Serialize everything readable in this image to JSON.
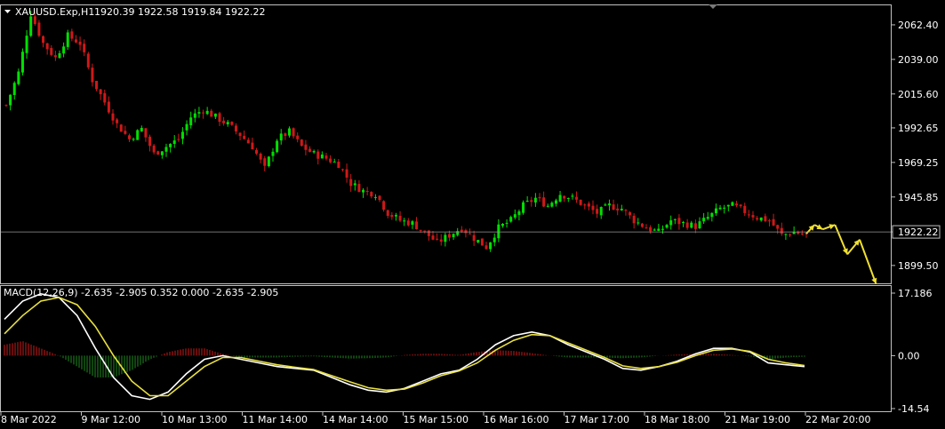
{
  "header": {
    "symbol": "XAUUSD.Exp,H1",
    "ohlc": "1920.39 1922.58 1919.84 1922.22"
  },
  "macd_header": {
    "label": "MACD(12,26,9) -2.635 -2.905 0.352 0.000 -2.635 -2.905"
  },
  "colors": {
    "background": "#000000",
    "bull": "#00e000",
    "bear": "#d01818",
    "macd_line": "#ffffff",
    "signal_line": "#e8e040",
    "arrows": "#f0e030",
    "grid_border": "#c0c0c0"
  },
  "chart_data": [
    {
      "type": "candlestick",
      "title": "XAUUSD.Exp,H1",
      "ylim": [
        1888,
        2075
      ],
      "y_ticks": [
        "2062.40",
        "2039.00",
        "2015.60",
        "1992.65",
        "1969.25",
        "1945.85",
        "1922.22",
        "1899.50"
      ],
      "current_price": "1922.22",
      "x_ticks": [
        "8 Mar 2022",
        "9 Mar 12:00",
        "10 Mar 13:00",
        "11 Mar 14:00",
        "14 Mar 14:00",
        "15 Mar 15:00",
        "16 Mar 16:00",
        "17 Mar 17:00",
        "18 Mar 18:00",
        "21 Mar 19:00",
        "22 Mar 20:00"
      ],
      "close_path": [
        [
          0,
          2008
        ],
        [
          3,
          2030
        ],
        [
          6,
          2070
        ],
        [
          9,
          2050
        ],
        [
          12,
          2040
        ],
        [
          15,
          2055
        ],
        [
          18,
          2050
        ],
        [
          21,
          2025
        ],
        [
          24,
          2010
        ],
        [
          27,
          1995
        ],
        [
          30,
          1985
        ],
        [
          33,
          1992
        ],
        [
          36,
          1975
        ],
        [
          39,
          1980
        ],
        [
          42,
          1985
        ],
        [
          45,
          2000
        ],
        [
          48,
          2005
        ],
        [
          51,
          2000
        ],
        [
          54,
          1995
        ],
        [
          57,
          1988
        ],
        [
          60,
          1980
        ],
        [
          63,
          1965
        ],
        [
          66,
          1985
        ],
        [
          69,
          1990
        ],
        [
          72,
          1980
        ],
        [
          75,
          1975
        ],
        [
          78,
          1972
        ],
        [
          81,
          1968
        ],
        [
          84,
          1955
        ],
        [
          87,
          1950
        ],
        [
          90,
          1948
        ],
        [
          93,
          1935
        ],
        [
          96,
          1930
        ],
        [
          99,
          1928
        ],
        [
          102,
          1922
        ],
        [
          105,
          1915
        ],
        [
          108,
          1920
        ],
        [
          111,
          1925
        ],
        [
          114,
          1918
        ],
        [
          117,
          1912
        ],
        [
          120,
          1925
        ],
        [
          123,
          1930
        ],
        [
          126,
          1940
        ],
        [
          129,
          1945
        ],
        [
          132,
          1940
        ],
        [
          135,
          1948
        ],
        [
          138,
          1945
        ],
        [
          141,
          1940
        ],
        [
          144,
          1935
        ],
        [
          147,
          1940
        ],
        [
          150,
          1938
        ],
        [
          153,
          1930
        ],
        [
          156,
          1925
        ],
        [
          159,
          1922
        ],
        [
          162,
          1930
        ],
        [
          165,
          1928
        ],
        [
          168,
          1926
        ],
        [
          171,
          1932
        ],
        [
          174,
          1938
        ],
        [
          177,
          1940
        ],
        [
          180,
          1936
        ],
        [
          183,
          1932
        ],
        [
          186,
          1930
        ],
        [
          189,
          1920
        ],
        [
          192,
          1922
        ],
        [
          195,
          1920
        ]
      ],
      "forecast_path": [
        [
          195,
          1921
        ],
        [
          197,
          1927
        ],
        [
          199,
          1924
        ],
        [
          202,
          1927
        ],
        [
          205,
          1907
        ],
        [
          208,
          1917
        ],
        [
          212,
          1887
        ]
      ]
    },
    {
      "type": "line",
      "title": "MACD(12,26,9)",
      "ylim": [
        -14.54,
        17.186
      ],
      "y_ticks": [
        "17.186",
        "0.00",
        "-14.54"
      ],
      "series": [
        {
          "name": "MACD(12,26,9)",
          "values": [
            10,
            15,
            17,
            16,
            11,
            2,
            -6,
            -11,
            -12,
            -10,
            -5,
            -1,
            0,
            -1,
            -2,
            -3,
            -3.5,
            -4,
            -6,
            -8,
            -9.5,
            -10,
            -9,
            -7,
            -5,
            -4,
            -1,
            3,
            5.5,
            6.5,
            5.5,
            3,
            1,
            -1,
            -3.5,
            -4,
            -3,
            -1.5,
            0.5,
            2,
            2,
            1,
            -2,
            -2.5,
            -3
          ]
        },
        {
          "name": "Signal",
          "values": [
            6,
            11,
            15,
            16,
            14,
            8,
            0,
            -7,
            -11,
            -11,
            -7,
            -3,
            -0.5,
            -0.5,
            -1.5,
            -2.5,
            -3.2,
            -3.8,
            -5.5,
            -7.2,
            -8.8,
            -9.5,
            -9.2,
            -7.5,
            -5.5,
            -4.2,
            -2,
            1.5,
            4.2,
            5.8,
            5.5,
            3.5,
            1.5,
            -0.5,
            -2.8,
            -3.5,
            -3,
            -1.8,
            0,
            1.5,
            1.8,
            1.2,
            -1,
            -2,
            -2.7
          ]
        }
      ],
      "histogram": [
        3,
        4,
        2,
        0,
        -3,
        -6,
        -6,
        -4,
        -1,
        1,
        2,
        2,
        0.5,
        -0.5,
        -0.5,
        -0.5,
        -0.3,
        -0.2,
        -0.5,
        -0.8,
        -0.7,
        -0.5,
        0.2,
        0.5,
        0.5,
        0.2,
        1,
        1.5,
        1.3,
        0.7,
        0,
        -0.5,
        -0.5,
        -0.5,
        -0.7,
        -0.5,
        0,
        0.3,
        0.5,
        0.5,
        0.2,
        -0.2,
        -1,
        -0.5,
        -0.3
      ]
    }
  ]
}
